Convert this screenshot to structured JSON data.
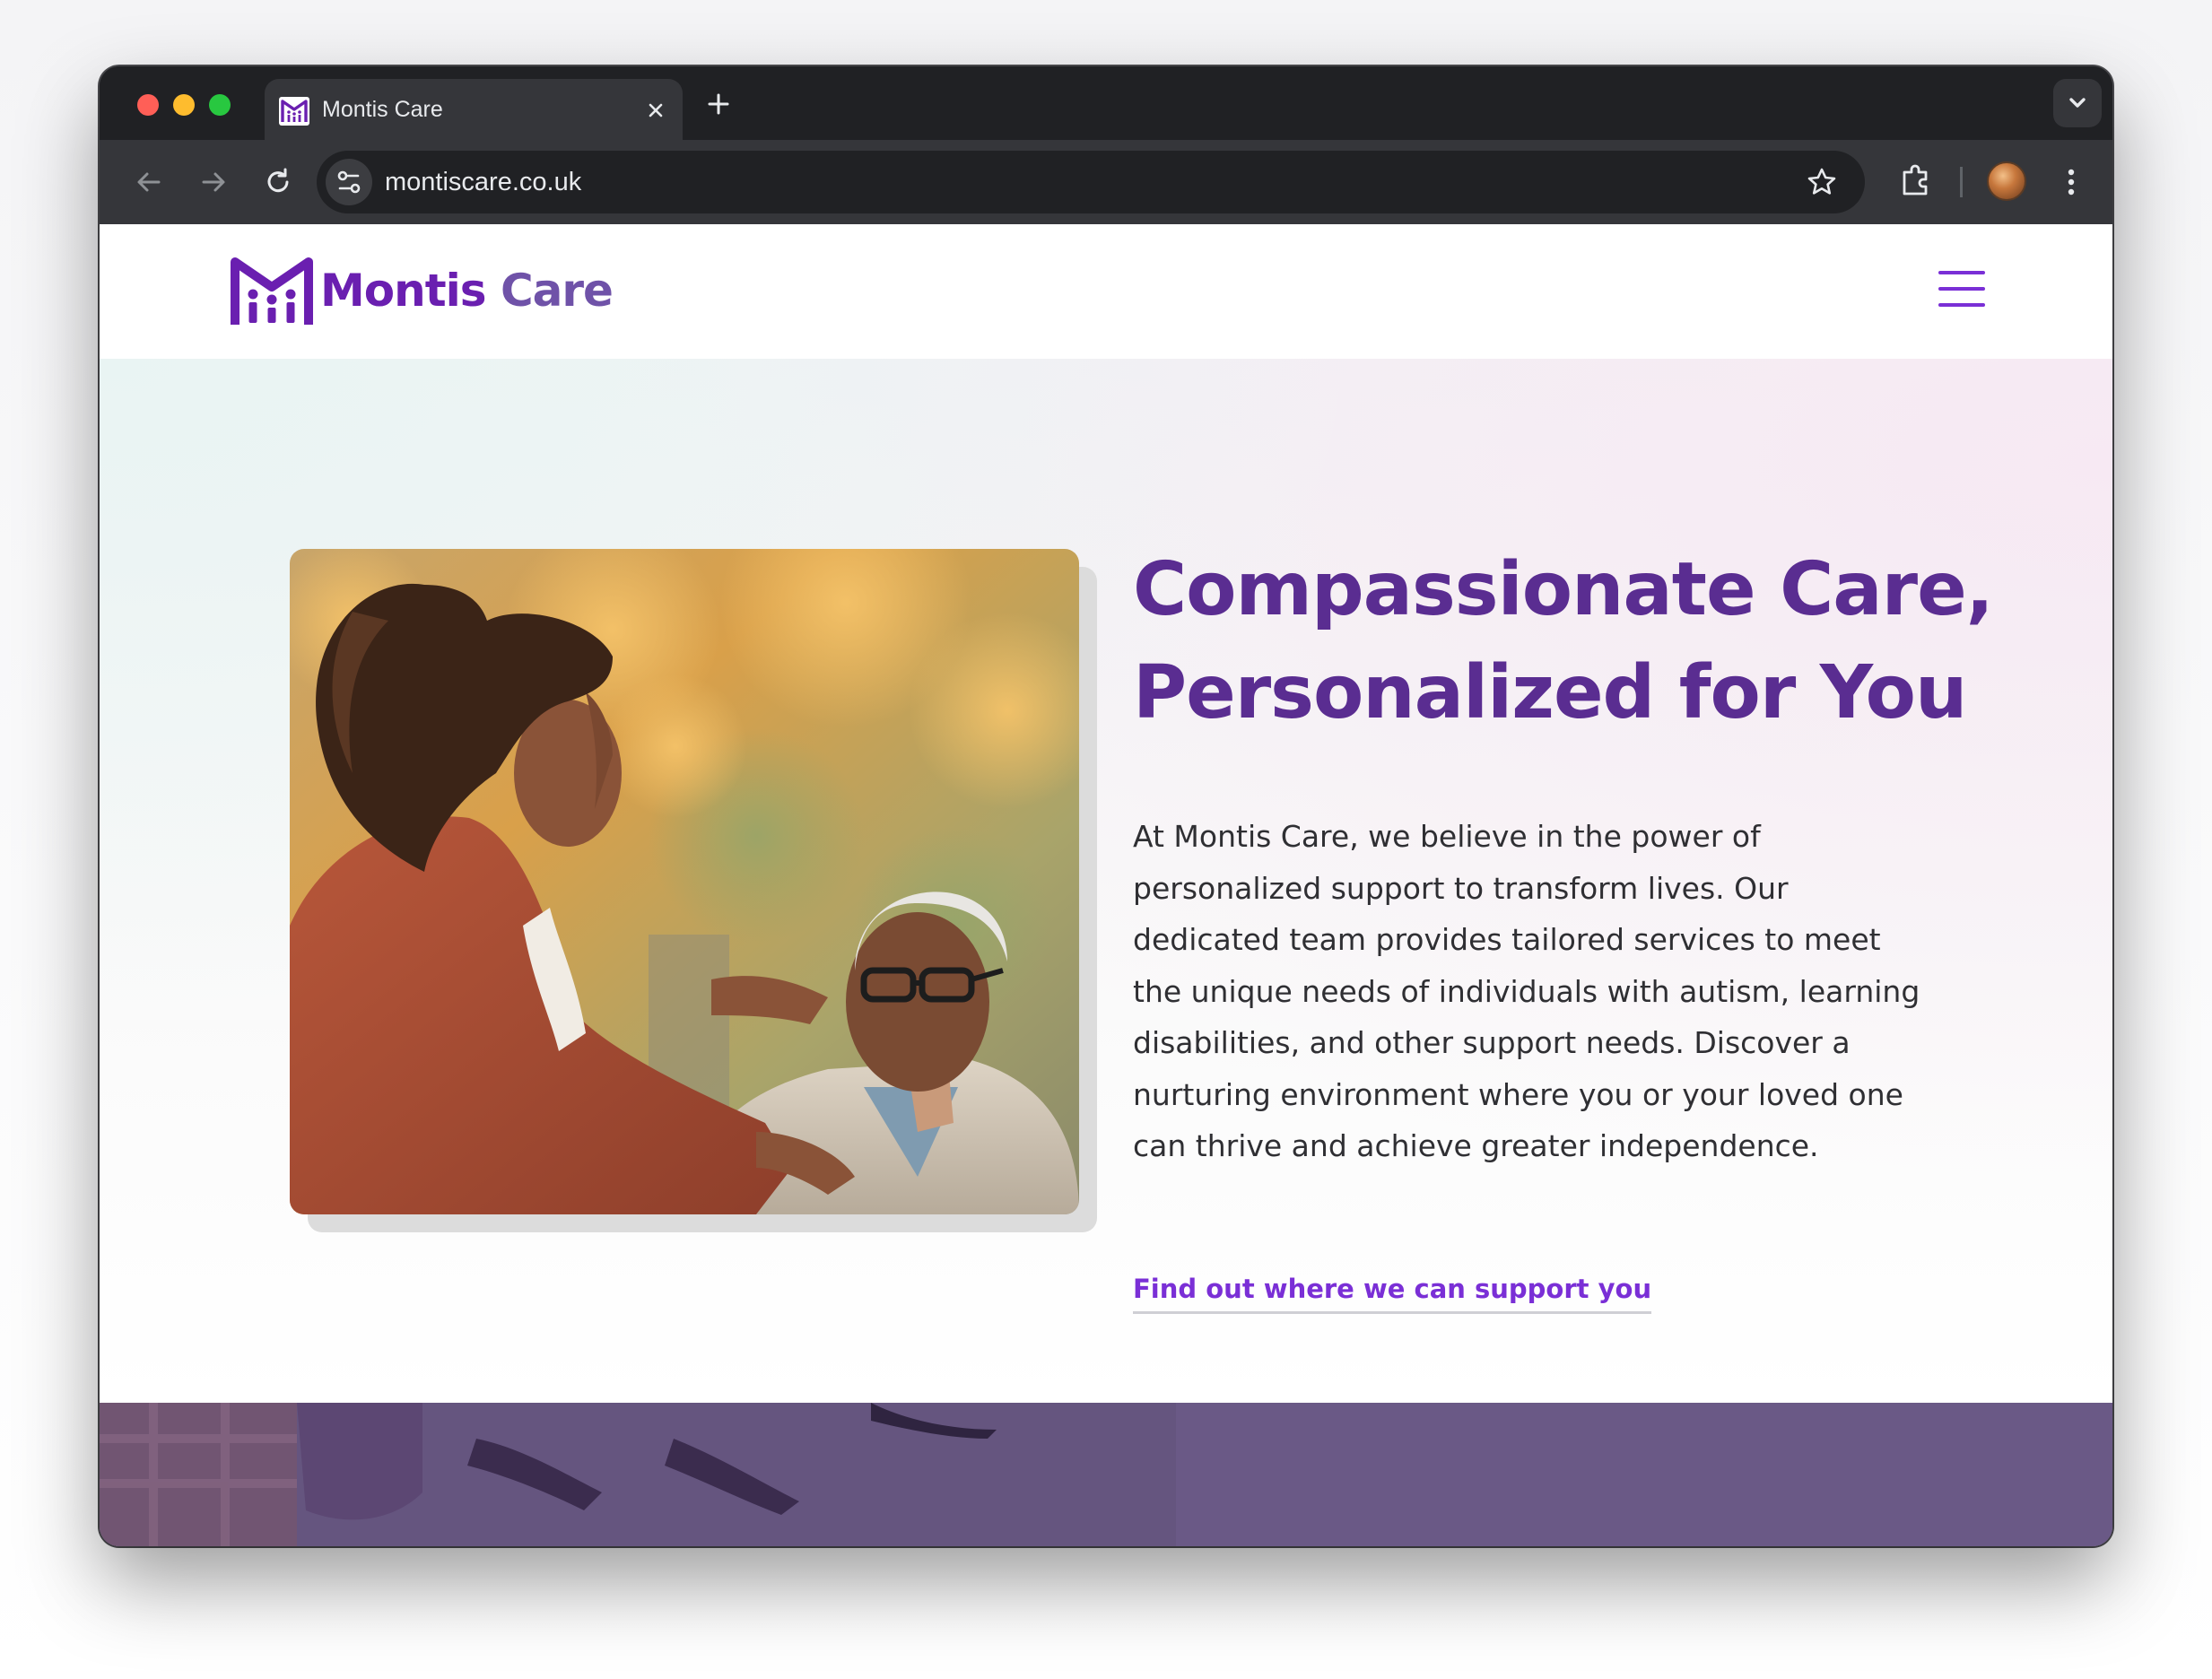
{
  "browser": {
    "tab_title": "Montis Care",
    "url": "montiscare.co.uk"
  },
  "site": {
    "logo_word1": "Montis",
    "logo_word2": "Care",
    "brand_color": "#6a1fb0",
    "accent_color": "#7a2fd6"
  },
  "hero": {
    "title_line1": "Compassionate Care,",
    "title_line2": "Personalized for You",
    "body": "At Montis Care, we believe in the power of personalized support to transform lives. Our dedicated team provides tailored services to meet the unique needs of individuals with autism, learning disabilities, and other support needs. Discover a nurturing environment where you or your loved one can thrive and achieve greater independence.",
    "link_label": "Find out where we can support you"
  },
  "icons": {
    "favicon": "montis-logo-icon",
    "tab_close": "close-icon",
    "new_tab": "plus-icon",
    "tab_search": "chevron-down-icon",
    "back": "arrow-left-icon",
    "forward": "arrow-right-icon",
    "reload": "reload-icon",
    "site_info": "tune-icon",
    "bookmark": "star-icon",
    "extensions": "puzzle-icon",
    "menu": "kebab-icon",
    "nav_menu": "hamburger-icon"
  }
}
